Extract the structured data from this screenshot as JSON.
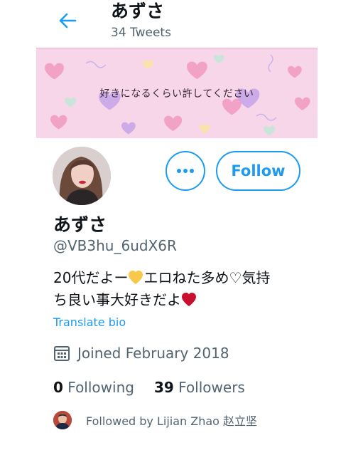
{
  "header": {
    "name": "あずさ",
    "tweet_count": "34 Tweets"
  },
  "banner": {
    "text": "好きになるくらい許してください",
    "background_color": "#f7d6ea"
  },
  "profile": {
    "display_name": "あずさ",
    "handle": "@VB3hu_6udX6R",
    "bio_part1": "20代だよー",
    "bio_part2": "エロねた多め♡気持",
    "bio_part3": "ち良い事大好きだよ",
    "translate_label": "Translate bio",
    "joined": "Joined February 2018",
    "following_count": "0",
    "following_label": "Following",
    "followers_count": "39",
    "followers_label": "Followers",
    "followed_by": "Followed by Lijian Zhao 赵立坚"
  },
  "actions": {
    "more_icon": "ellipsis-icon",
    "follow_label": "Follow"
  },
  "colors": {
    "accent": "#1d9bf0",
    "secondary_text": "#536471",
    "heart_yellow": "#f7c84a",
    "heart_red": "#c8102e"
  }
}
